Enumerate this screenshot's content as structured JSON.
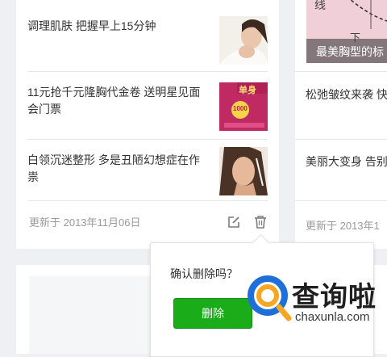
{
  "articles": [
    {
      "title": "调理肌肤 把握早上15分钟",
      "thumb_icon": "woman-face-thumbnail"
    },
    {
      "title": "11元抢千元隆胸代金卷 送明星见面会门票",
      "thumb_icon": "promo-poster-thumbnail",
      "thumb_text": "单身",
      "thumb_badge": "1000"
    },
    {
      "title": "白领沉迷整形 多是丑陋幻想症在作祟",
      "thumb_icon": "woman-portrait-thumbnail"
    }
  ],
  "left_footer": {
    "date": "更新于 2013年11月06日",
    "edit_icon": "edit-icon",
    "delete_icon": "trash-icon"
  },
  "right_card": {
    "hero_caption": "最美胸型的标",
    "hero_text_a": "线",
    "hero_text_b": "下",
    "items": [
      "松弛皱纹来袭 快",
      "美丽大变身 告别"
    ],
    "date": "更新于 2013年1"
  },
  "popover": {
    "message": "确认删除吗？",
    "delete_label": "删除"
  },
  "watermark": {
    "logo_text": "查询啦",
    "url": "chaxunla.com"
  },
  "colors": {
    "accent_green": "#1aad19",
    "watermark_blue": "#1e6fd9",
    "watermark_orange": "#f5a623"
  }
}
